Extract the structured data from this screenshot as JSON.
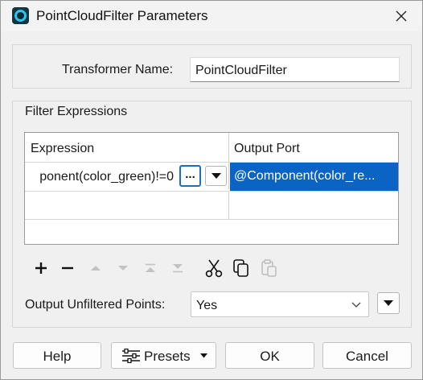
{
  "window": {
    "title": "PointCloudFilter Parameters"
  },
  "transformer": {
    "label": "Transformer Name:",
    "value": "PointCloudFilter"
  },
  "filter_group": {
    "title": "Filter Expressions",
    "columns": [
      "Expression",
      "Output Port"
    ],
    "rows": [
      {
        "expression": "ponent(color_green)!=0",
        "ellipsis": "...",
        "output_port": "@Component(color_re..."
      }
    ]
  },
  "unfiltered": {
    "label": "Output Unfiltered Points:",
    "value": "Yes"
  },
  "buttons": {
    "help": "Help",
    "presets": "Presets",
    "ok": "OK",
    "cancel": "Cancel"
  },
  "colors": {
    "selection": "#0b63c4",
    "focus_border": "#1f6fb8",
    "app_icon_ring": "#2fc5e8"
  }
}
